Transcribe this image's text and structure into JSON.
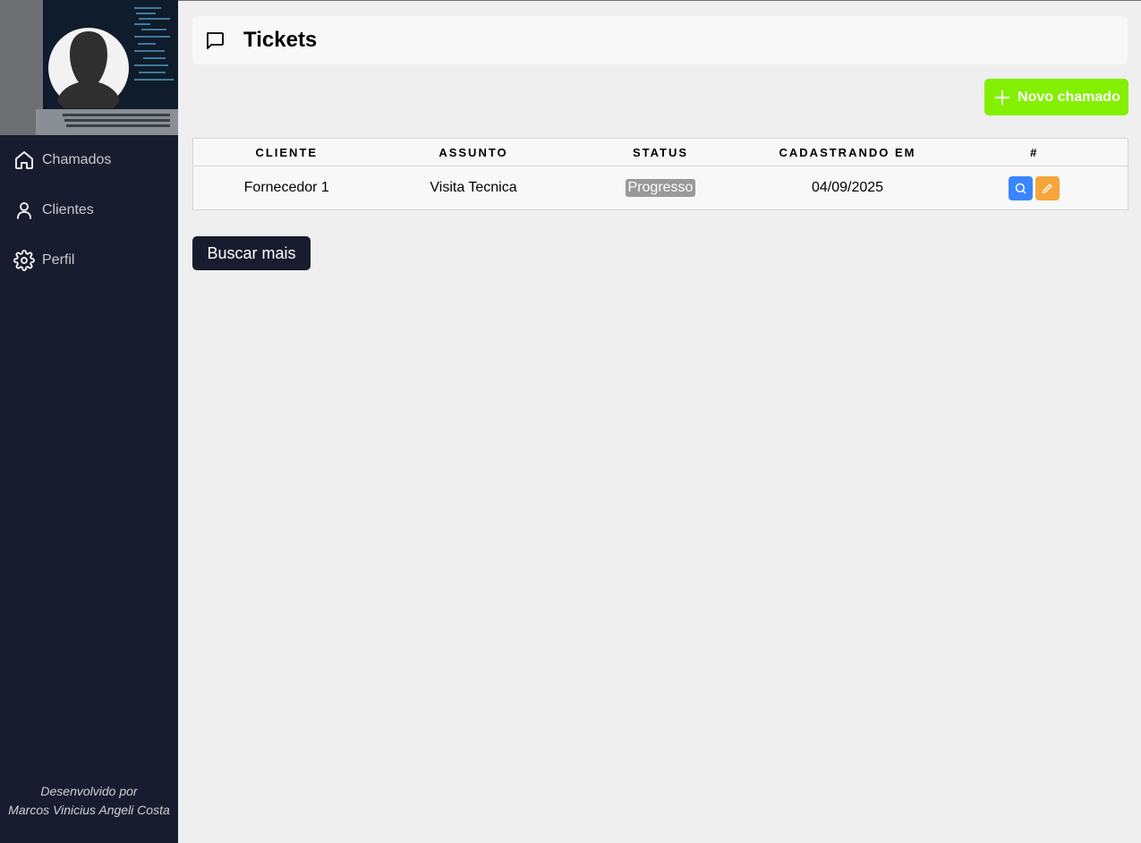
{
  "sidebar": {
    "items": [
      {
        "label": "Chamados",
        "icon": "home-icon"
      },
      {
        "label": "Clientes",
        "icon": "user-icon"
      },
      {
        "label": "Perfil",
        "icon": "gear-icon"
      }
    ],
    "footer_line1": "Desenvolvido por",
    "footer_line2": "Marcos Vinicius Angeli Costa"
  },
  "header": {
    "title": "Tickets",
    "icon": "message-icon"
  },
  "toolbar": {
    "new_label": "Novo chamado"
  },
  "table": {
    "columns": [
      "CLIENTE",
      "ASSUNTO",
      "STATUS",
      "CADASTRANDO EM",
      "#"
    ],
    "rows": [
      {
        "cliente": "Fornecedor 1",
        "assunto": "Visita Tecnica",
        "status": "Progresso",
        "data": "04/09/2025"
      }
    ]
  },
  "pagination": {
    "more_label": "Buscar mais"
  },
  "colors": {
    "sidebar": "#181c2e",
    "accent_green": "#83f000",
    "view_blue": "#3a86ff",
    "edit_orange": "#f6a53b",
    "status_grey": "#999999"
  }
}
